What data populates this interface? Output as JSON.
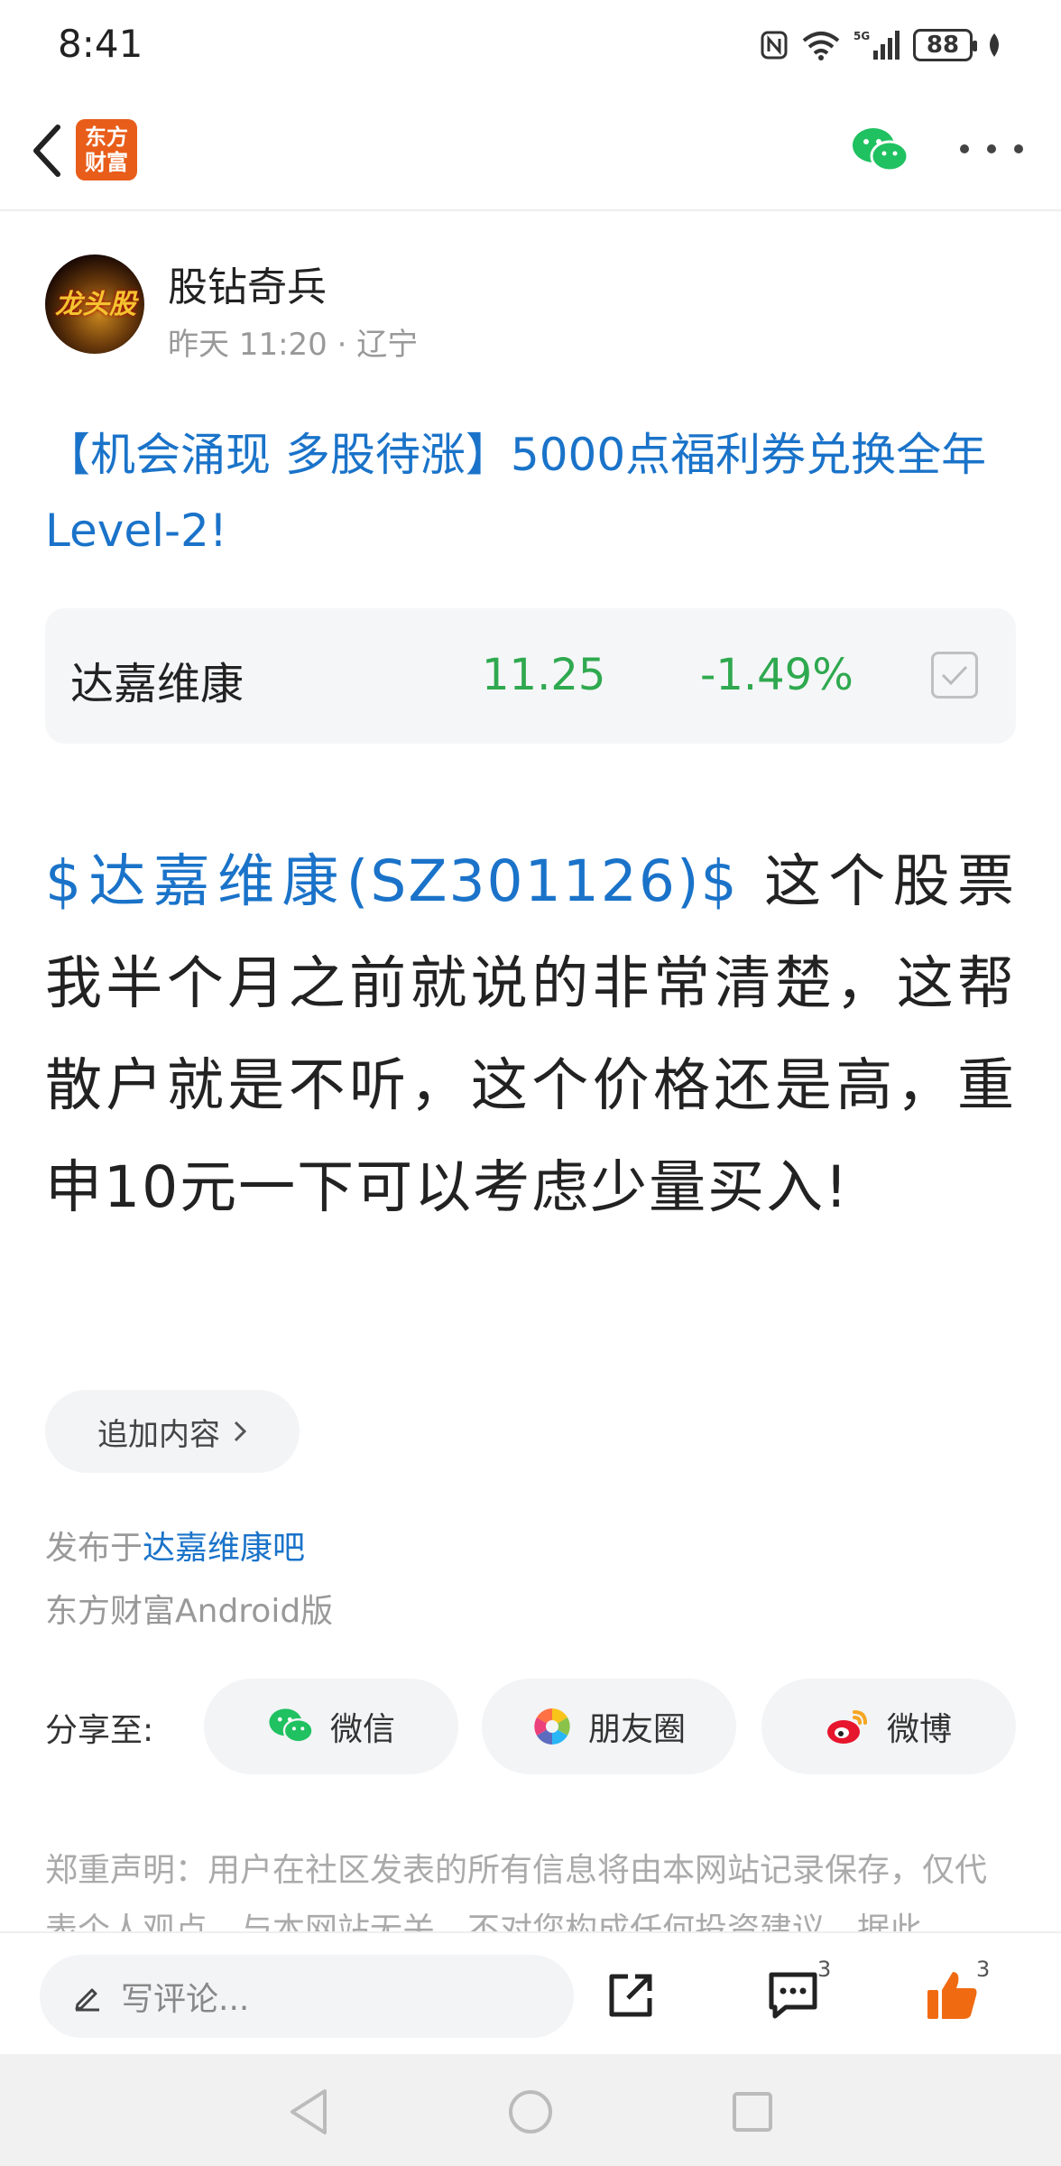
{
  "status_bar": {
    "time": "8:41",
    "battery": "88",
    "network": "5G"
  },
  "nav": {
    "app_logo_text": "东方财富"
  },
  "author": {
    "name": "股钻奇兵",
    "meta": "昨天 11:20 · 辽宁",
    "avatar_text": "龙头股"
  },
  "post": {
    "title": "【机会涌现 多股待涨】5000点福利券兑换全年Level-2!",
    "stock_link": "$达嘉维康(SZ301126)$",
    "body_text": " 这个股票我半个月之前就说的非常清楚，这帮散户就是不听，这个价格还是高，重申10元一下可以考虑少量买入!"
  },
  "stock_card": {
    "name": "达嘉维康",
    "price": "11.25",
    "change": "-1.49%"
  },
  "append_button": "追加内容",
  "published": {
    "prefix": "发布于",
    "forum": "达嘉维康吧",
    "client": "东方财富Android版"
  },
  "share": {
    "label": "分享至:",
    "wechat": "微信",
    "moments": "朋友圈",
    "weibo": "微博"
  },
  "disclaimer": "郑重声明：用户在社区发表的所有信息将由本网站记录保存，仅代表个人观点，与本网站无关，不对您构成任何投资建议，据此",
  "bottom_bar": {
    "comment_placeholder": "写评论...",
    "comment_count": "3",
    "like_count": "3"
  },
  "colors": {
    "link_blue": "#1a73c9",
    "down_green": "#2fa94f",
    "brand_orange": "#e85d1a",
    "like_orange": "#f06a12"
  }
}
